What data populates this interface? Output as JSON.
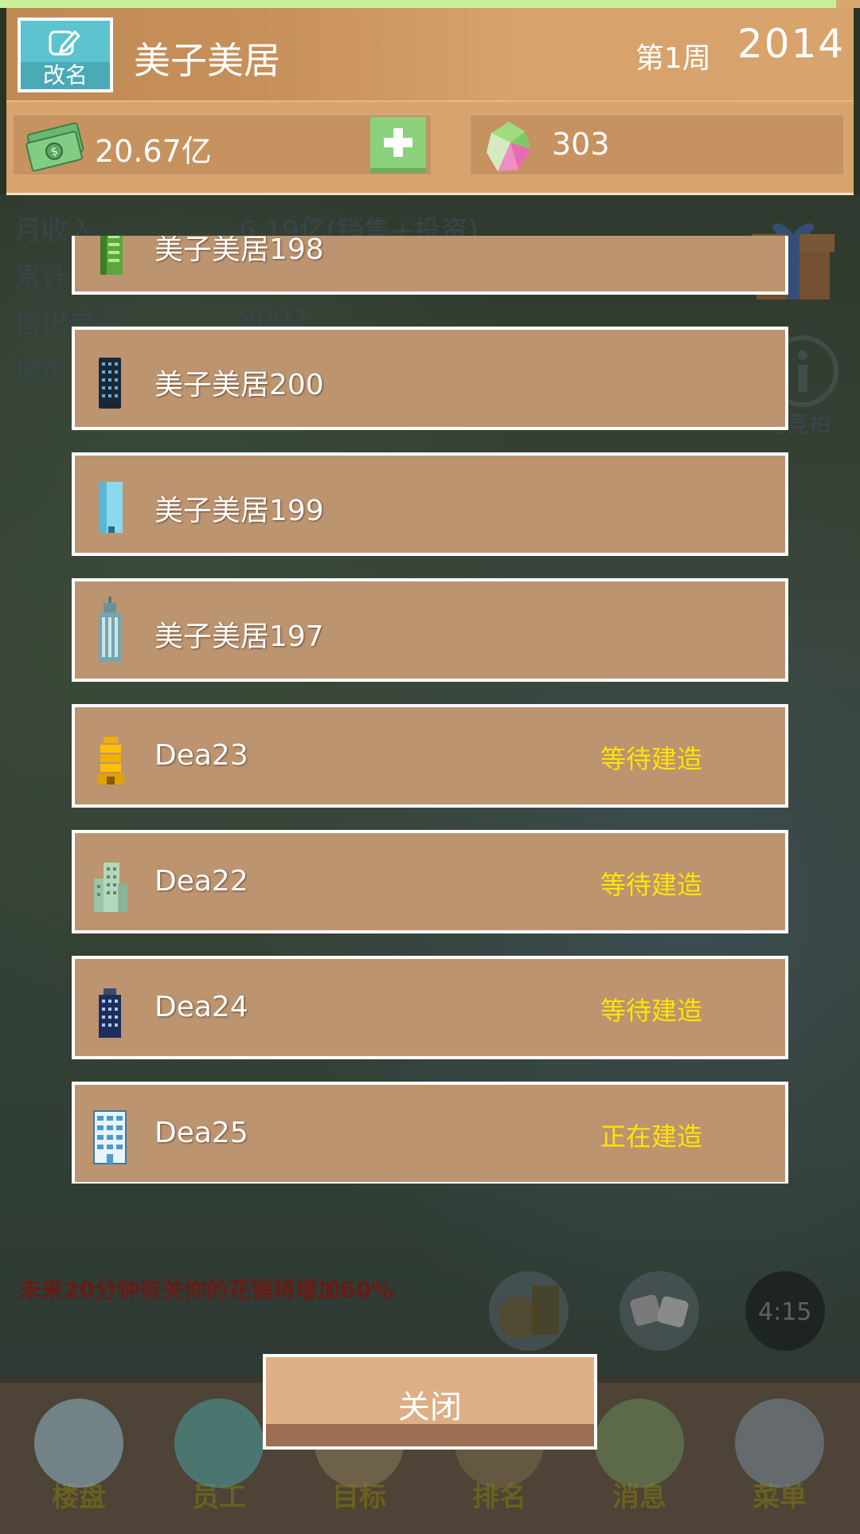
{
  "header": {
    "rename_label": "改名",
    "company_name": "美子美居",
    "week": "第1周",
    "year": "2014",
    "money": "20.67亿",
    "gems": "303"
  },
  "background_stats": [
    {
      "label": "月收入",
      "value": "6.19亿(销售+投资)"
    },
    {
      "label": "累计",
      "value": ""
    },
    {
      "label": "售出房子",
      "value": "9002"
    },
    {
      "label": "城市",
      "value": ""
    }
  ],
  "background_side": {
    "info_label": "可竞拍"
  },
  "buildings": [
    {
      "name": "美子美居198",
      "status": "",
      "icon": "green-tower-icon"
    },
    {
      "name": "美子美居200",
      "status": "",
      "icon": "dark-tower-icon"
    },
    {
      "name": "美子美居199",
      "status": "",
      "icon": "glass-tower-icon"
    },
    {
      "name": "美子美居197",
      "status": "",
      "icon": "skyscraper-icon"
    },
    {
      "name": "Dea23",
      "status": "等待建造",
      "icon": "golden-tower-icon"
    },
    {
      "name": "Dea22",
      "status": "等待建造",
      "icon": "office-block-icon"
    },
    {
      "name": "Dea24",
      "status": "等待建造",
      "icon": "navy-tower-icon"
    },
    {
      "name": "Dea25",
      "status": "正在建造",
      "icon": "blue-apartment-icon"
    }
  ],
  "notice": "未来20分钟有关你的花销将增加60%",
  "timer": "4:15",
  "close_label": "关闭",
  "nav": [
    {
      "label": "楼盘",
      "icon": "building-icon"
    },
    {
      "label": "员工",
      "icon": "handshake-icon"
    },
    {
      "label": "目标",
      "icon": "target-icon"
    },
    {
      "label": "排名",
      "icon": "ranking-icon"
    },
    {
      "label": "消息",
      "icon": "message-icon"
    },
    {
      "label": "菜单",
      "icon": "menu-icon"
    }
  ],
  "colors": {
    "header_bg": "#d8a36c",
    "list_item_bg": "#bc9470",
    "status_text": "#ffe400",
    "plus_button": "#8bd07a",
    "rename_button": "#5bc4cf",
    "close_button": "#deae86"
  }
}
